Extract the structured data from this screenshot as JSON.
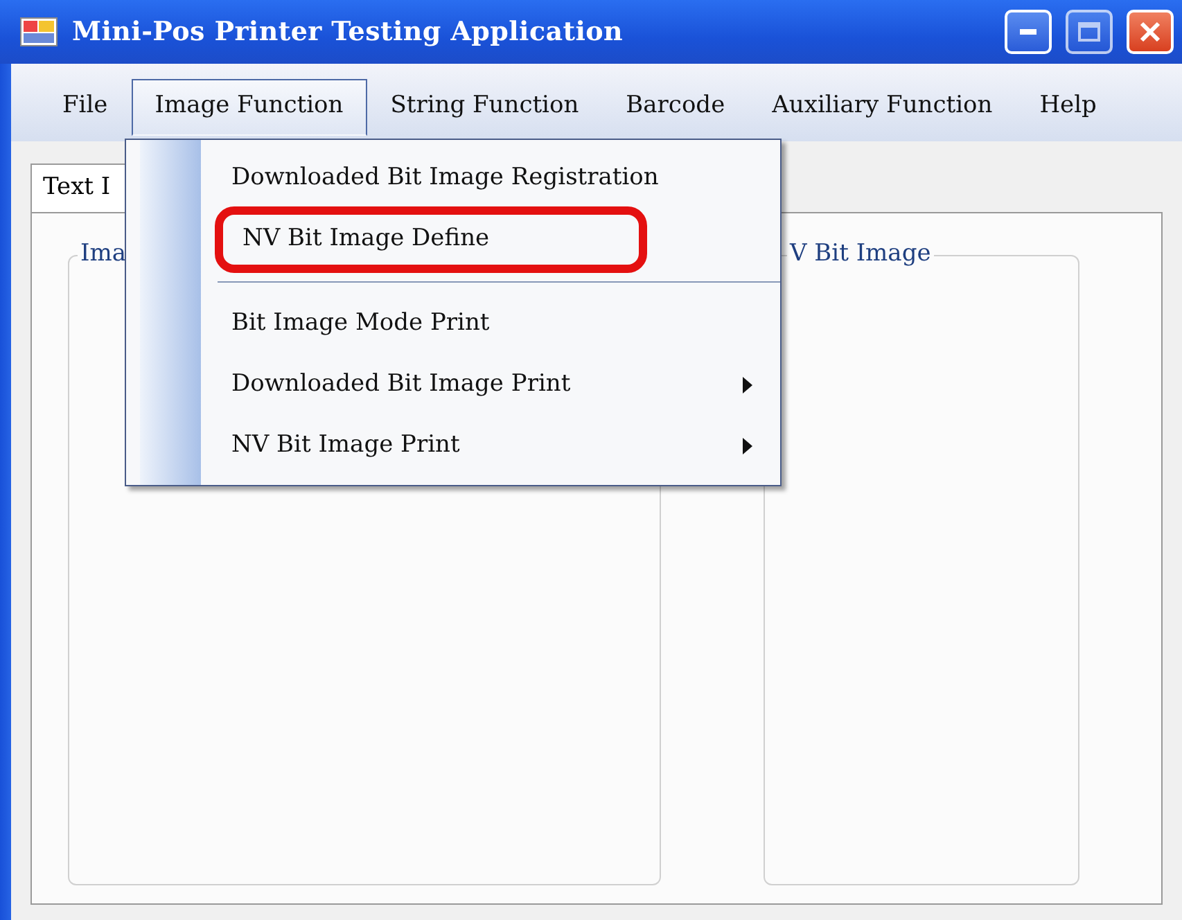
{
  "window": {
    "title": "Mini-Pos Printer Testing Application"
  },
  "menu": [
    {
      "label": "File",
      "selected": false
    },
    {
      "label": "Image Function",
      "selected": true
    },
    {
      "label": "String Function",
      "selected": false
    },
    {
      "label": "Barcode",
      "selected": false
    },
    {
      "label": "Auxiliary Function",
      "selected": false
    },
    {
      "label": "Help",
      "selected": false
    }
  ],
  "dropdown": [
    {
      "kind": "item",
      "label": "Downloaded Bit Image Registration",
      "submenu": false,
      "circled": false
    },
    {
      "kind": "item",
      "label": "NV Bit Image Define",
      "submenu": false,
      "circled": true
    },
    {
      "kind": "separator"
    },
    {
      "kind": "item",
      "label": "Bit Image Mode Print",
      "submenu": false,
      "circled": false
    },
    {
      "kind": "item",
      "label": "Downloaded Bit Image Print",
      "submenu": true,
      "circled": false
    },
    {
      "kind": "item",
      "label": "NV Bit Image Print",
      "submenu": true,
      "circled": false
    }
  ],
  "tabs": [
    {
      "label": "Text I",
      "selected": true
    }
  ],
  "groups": [
    {
      "title": "Ima"
    },
    {
      "title": "V Bit Image"
    }
  ]
}
